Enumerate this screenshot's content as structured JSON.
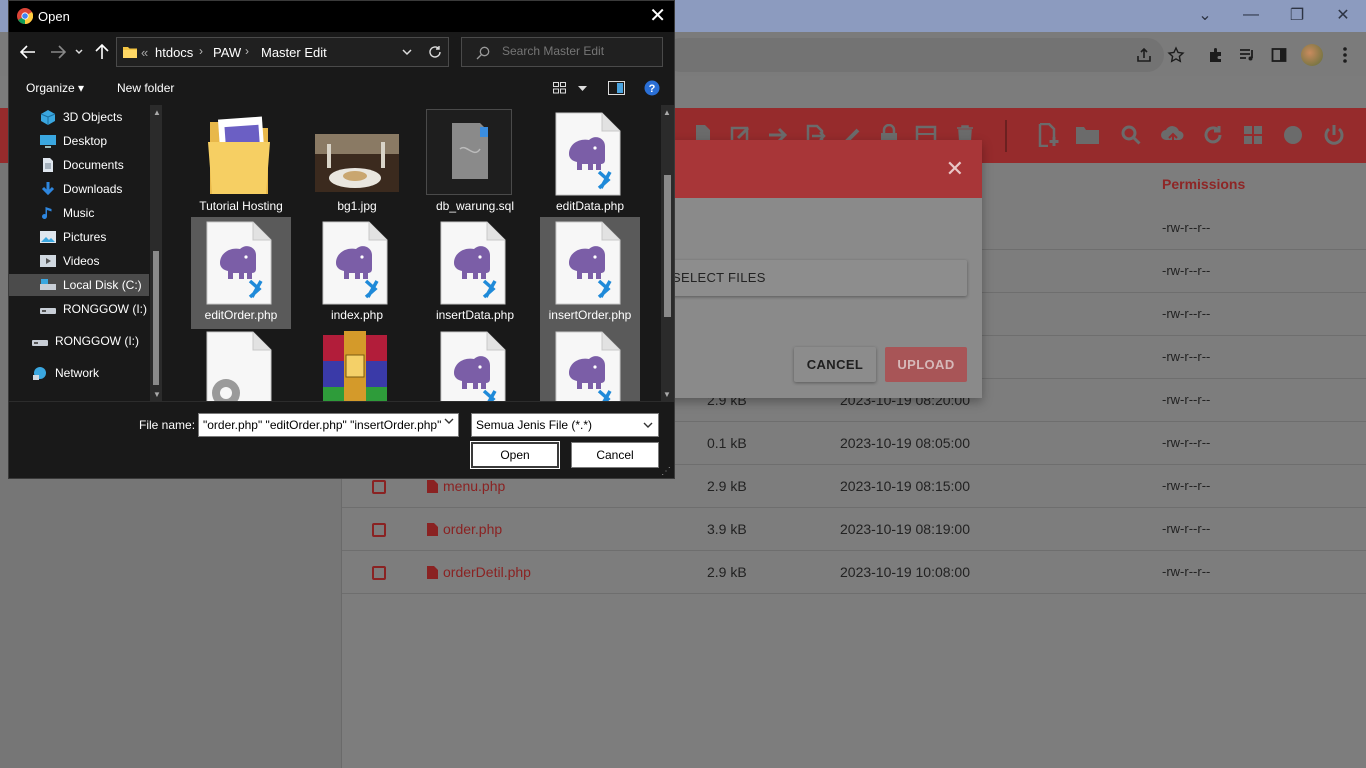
{
  "colors": {
    "accent": "#e53935",
    "dialog_bg": "#191919",
    "overlay": "#7a7a7a"
  },
  "dialog": {
    "title": "Open",
    "close_icon": "close-icon",
    "path": {
      "overflow": "«",
      "segments": [
        "htdocs",
        "PAW",
        "Master Edit"
      ]
    },
    "search_placeholder": "Search Master Edit",
    "toolbar": {
      "organize": "Organize ▾",
      "new_folder": "New folder"
    },
    "nav": [
      {
        "label": "3D Objects",
        "icon": "3d-objects-icon"
      },
      {
        "label": "Desktop",
        "icon": "desktop-icon"
      },
      {
        "label": "Documents",
        "icon": "documents-icon"
      },
      {
        "label": "Downloads",
        "icon": "downloads-icon"
      },
      {
        "label": "Music",
        "icon": "music-icon"
      },
      {
        "label": "Pictures",
        "icon": "pictures-icon"
      },
      {
        "label": "Videos",
        "icon": "videos-icon"
      },
      {
        "label": "Local Disk (C:)",
        "icon": "drive-icon",
        "selected": true
      },
      {
        "label": "RONGGOW (I:)",
        "icon": "usb-drive-icon"
      },
      {
        "label": "RONGGOW (I:)",
        "icon": "usb-drive-icon"
      },
      {
        "label": "Network",
        "icon": "network-icon"
      }
    ],
    "files": [
      {
        "name": "Tutorial Hosting",
        "type": "folder"
      },
      {
        "name": "bg1.jpg",
        "type": "image"
      },
      {
        "name": "db_warung.sql",
        "type": "sql"
      },
      {
        "name": "editData.php",
        "type": "php"
      },
      {
        "name": "editOrder.php",
        "type": "php",
        "selected": true
      },
      {
        "name": "index.php",
        "type": "php"
      },
      {
        "name": "insertData.php",
        "type": "php"
      },
      {
        "name": "insertOrder.php",
        "type": "php",
        "selected": true
      },
      {
        "name": "",
        "type": "settings"
      },
      {
        "name": "",
        "type": "archive"
      },
      {
        "name": "",
        "type": "php"
      },
      {
        "name": "",
        "type": "php",
        "selected": true
      }
    ],
    "file_name_label": "File name:",
    "file_name_value": "\"order.php\" \"editOrder.php\" \"insertOrder.php\"",
    "file_type": "Semua Jenis File (*.*)",
    "open_label": "Open",
    "cancel_label": "Cancel"
  },
  "modal": {
    "select_files_label": "SELECT FILES",
    "cancel_label": "CANCEL",
    "upload_label": "UPLOAD"
  },
  "table": {
    "permissions_header": "Permissions",
    "rows": [
      {
        "name": "",
        "size": "",
        "date": "",
        "perm": "-rw-r--r--"
      },
      {
        "name": "",
        "size": "",
        "date": "",
        "perm": "-rw-r--r--"
      },
      {
        "name": "",
        "size": "",
        "date": "",
        "perm": "-rw-r--r--"
      },
      {
        "name": "",
        "size": "",
        "date": "",
        "perm": "-rw-r--r--"
      },
      {
        "name": "",
        "size": "2.9 kB",
        "date": "2023-10-19 08:20:00",
        "perm": "-rw-r--r--"
      },
      {
        "name": "",
        "size": "0.1 kB",
        "date": "2023-10-19 08:05:00",
        "perm": "-rw-r--r--"
      },
      {
        "name": "menu.php",
        "size": "2.9 kB",
        "date": "2023-10-19 08:15:00",
        "perm": "-rw-r--r--"
      },
      {
        "name": "order.php",
        "size": "3.9 kB",
        "date": "2023-10-19 08:19:00",
        "perm": "-rw-r--r--"
      },
      {
        "name": "orderDetil.php",
        "size": "2.9 kB",
        "date": "2023-10-19 10:08:00",
        "perm": "-rw-r--r--"
      }
    ]
  }
}
